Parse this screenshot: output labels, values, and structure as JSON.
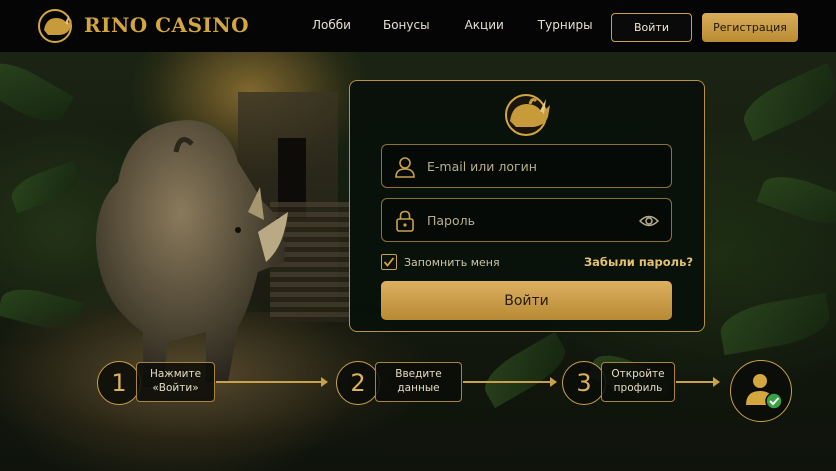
{
  "header": {
    "brand": "RINO CASINO",
    "nav": [
      "Лобби",
      "Бонусы",
      "Акции",
      "Турниры"
    ],
    "login_label": "Войти",
    "register_label": "Регистрация"
  },
  "login_card": {
    "email_placeholder": "E-mail или логин",
    "password_placeholder": "Пароль",
    "remember_label": "Запомнить меня",
    "remember_checked": true,
    "forgot_label": "Забыли пароль?",
    "submit_label": "Войти"
  },
  "steps": [
    {
      "number": "1",
      "line1": "Нажмите",
      "line2": "«Войти»"
    },
    {
      "number": "2",
      "line1": "Введите",
      "line2": "данные"
    },
    {
      "number": "3",
      "line1": "Откройте",
      "line2": "профиль"
    }
  ],
  "colors": {
    "gold": "#c9a14a",
    "gold_button": "#d4a63e",
    "header_bg": "#050505",
    "card_bg": "#08100a"
  },
  "icons": [
    "rhino-logo-icon",
    "user-icon",
    "lock-icon",
    "eye-icon",
    "checkmark-icon",
    "profile-verified-icon"
  ]
}
